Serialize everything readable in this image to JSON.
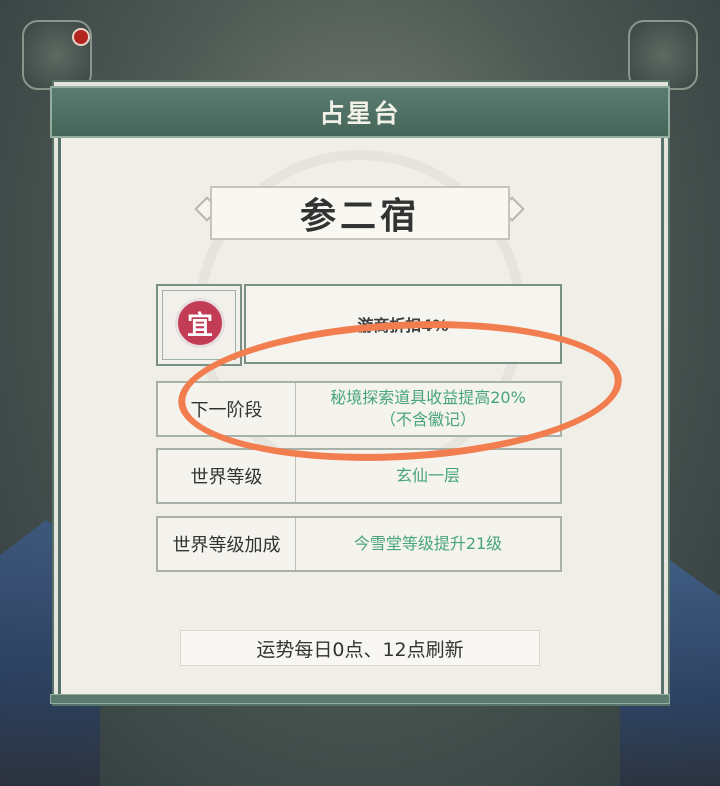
{
  "panel": {
    "title": "占星台"
  },
  "star": {
    "name": "参二宿"
  },
  "auspicious": {
    "badge": "宜",
    "effect": "游商折扣4%"
  },
  "rows": [
    {
      "label": "下一阶段",
      "value_line1": "秘境探索道具收益提高20%",
      "value_line2": "（不含徽记）"
    },
    {
      "label": "世界等级",
      "value_line1": "玄仙一层",
      "value_line2": ""
    },
    {
      "label": "世界等级加成",
      "value_line1": "今雪堂等级提升21级",
      "value_line2": ""
    }
  ],
  "footer": {
    "refresh_note": "运势每日0点、12点刷新"
  },
  "colors": {
    "header": "#4f6f63",
    "highlight_value": "#48a47b",
    "badge_red": "#c23c55",
    "annotation": "#f27d4e"
  },
  "icons": {
    "top_left": "letter-icon",
    "top_right": "rank-icon"
  }
}
